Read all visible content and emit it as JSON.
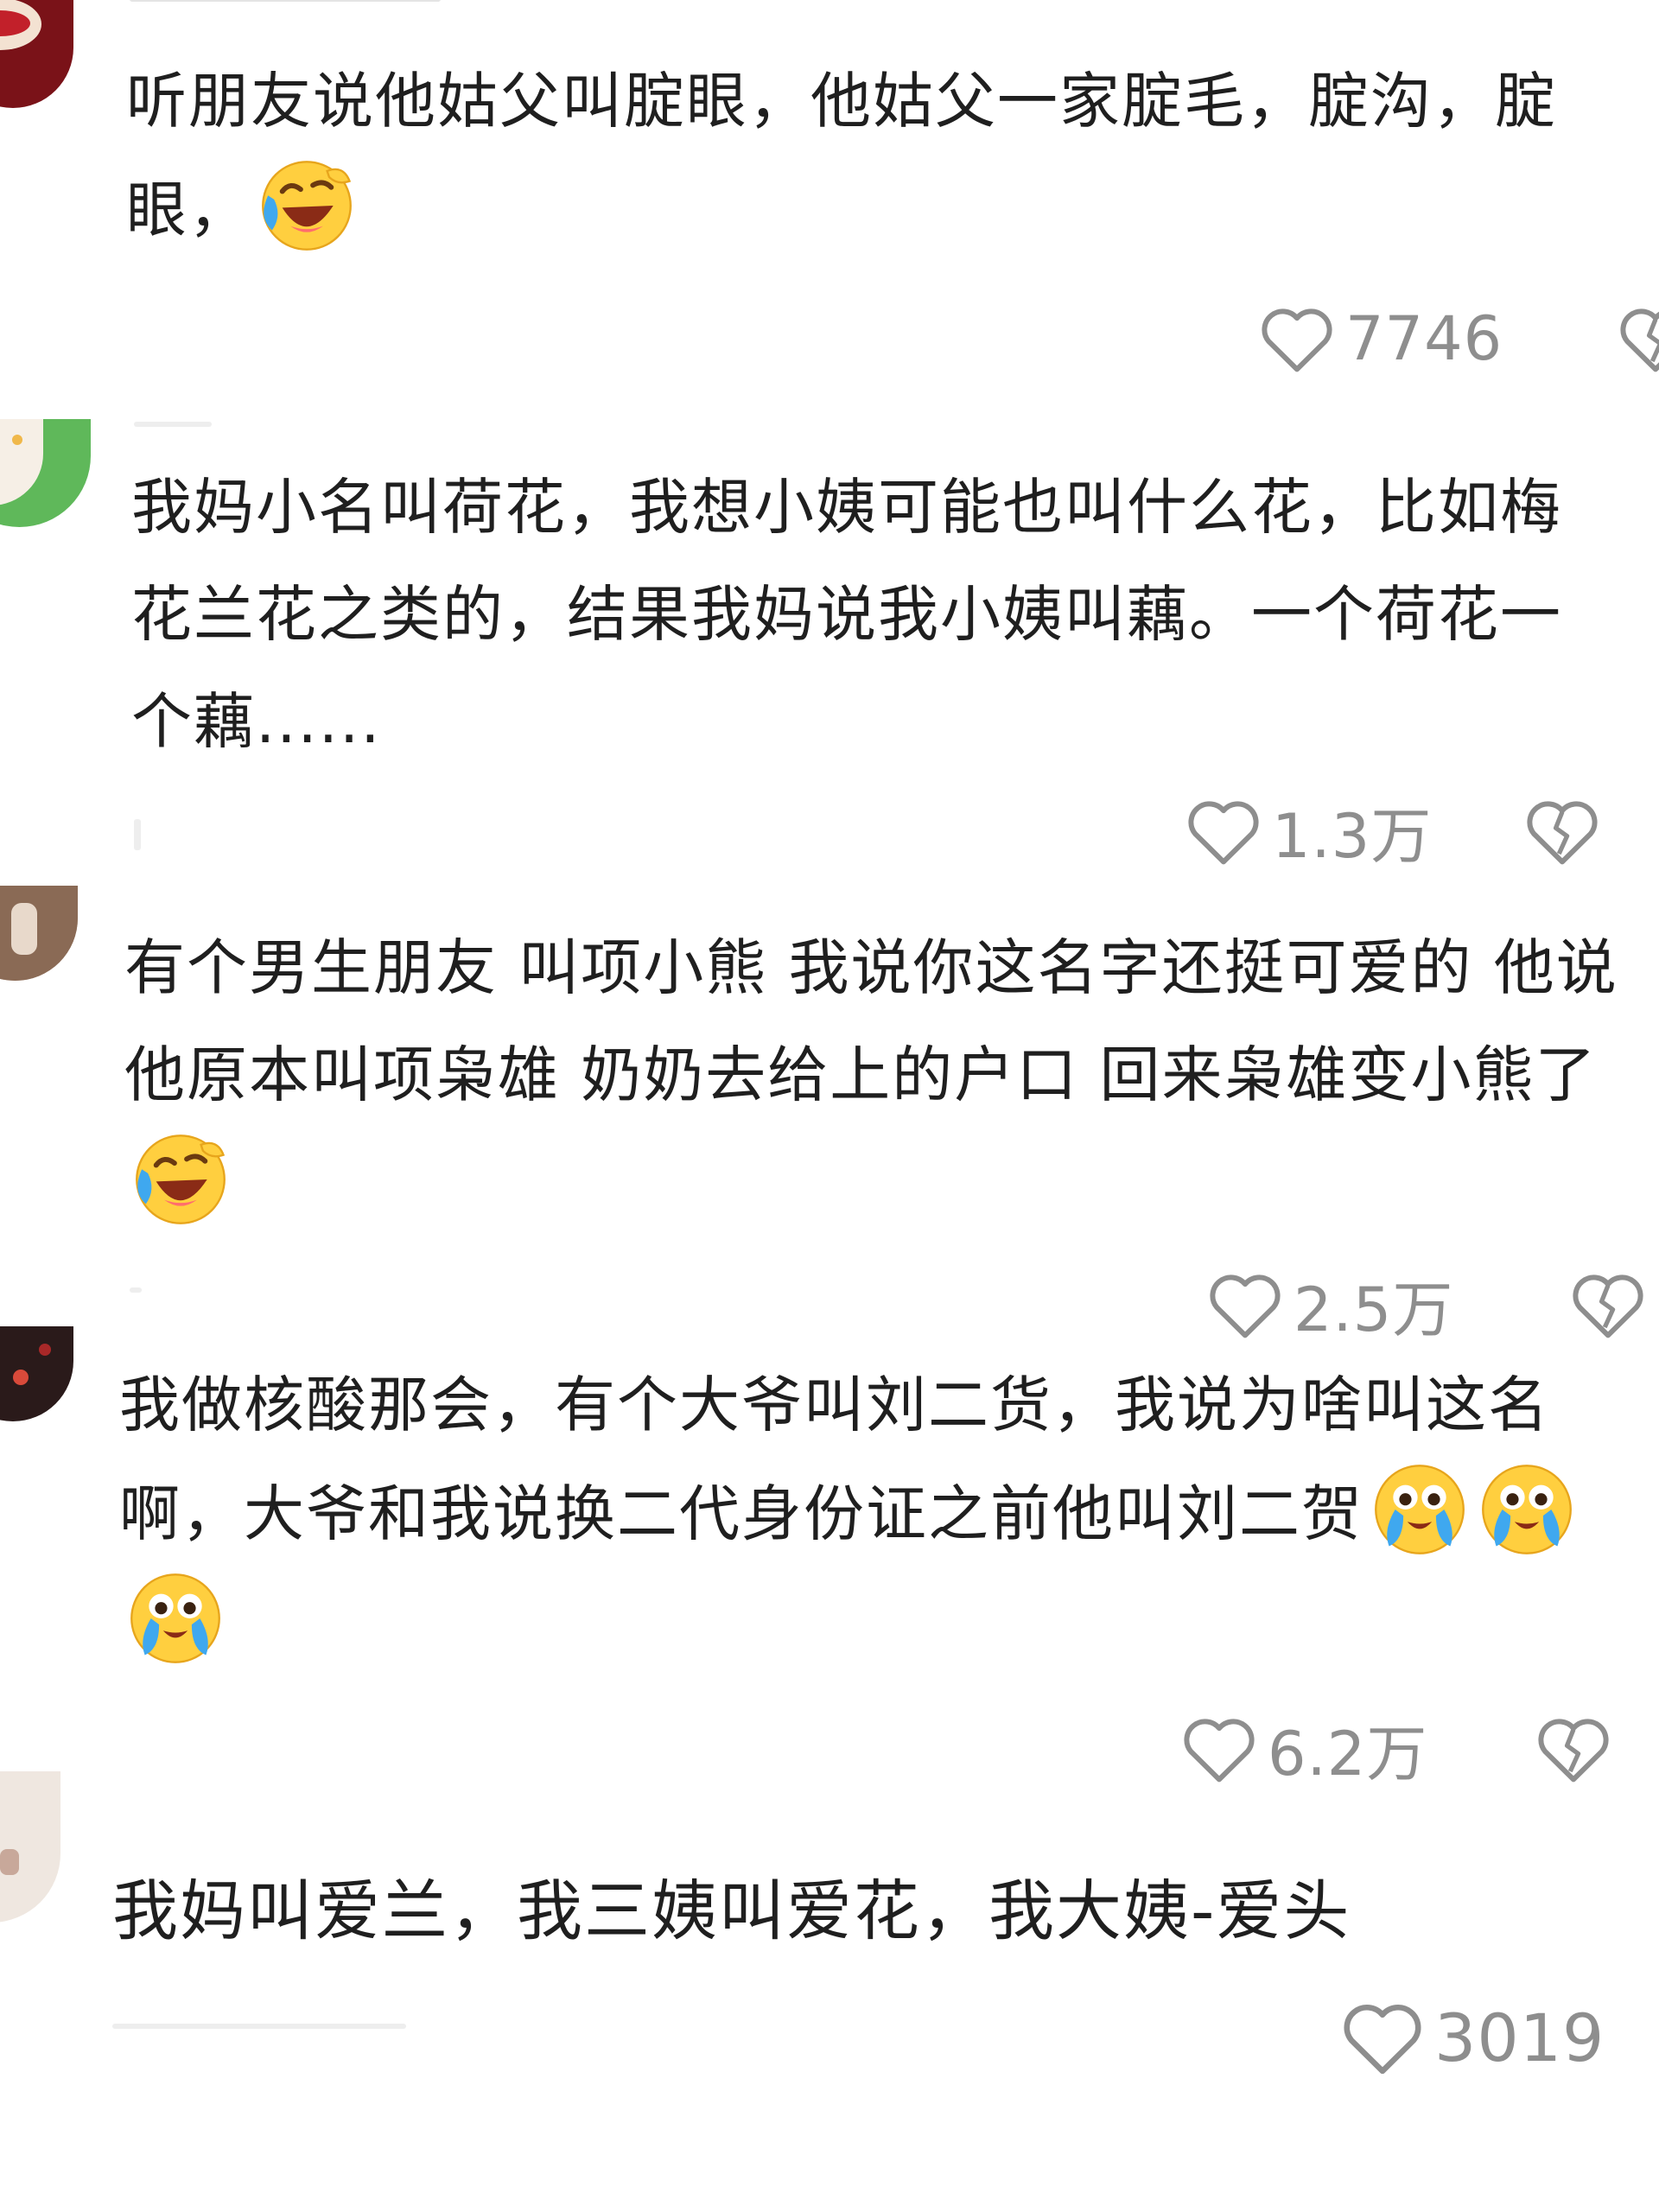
{
  "comments": [
    {
      "text": "听朋友说他姑父叫腚眼，他姑父一家腚毛，腚沟，腚眼，",
      "emoji": [
        "laugh-cry-emoji"
      ],
      "likes": "7746",
      "has_dislike": true
    },
    {
      "text": "我妈小名叫荷花，我想小姨可能也叫什么花，比如梅花兰花之类的，结果我妈说我小姨叫藕。一个荷花一个藕......",
      "emoji": [],
      "likes": "1.3万",
      "has_dislike": true
    },
    {
      "text": "有个男生朋友 叫项小熊 我说你这名字还挺可爱的 他说他原本叫项枭雄 奶奶去给上的户口 回来枭雄变小熊了",
      "emoji": [
        "laugh-cry-emoji"
      ],
      "likes": "2.5万",
      "has_dislike": true
    },
    {
      "text": "我做核酸那会，有个大爷叫刘二货，我说为啥叫这名啊，大爷和我说换二代身份证之前他叫刘二贺",
      "emoji": [
        "crying-emoji",
        "crying-emoji",
        "crying-emoji"
      ],
      "likes": "6.2万",
      "has_dislike": true
    },
    {
      "text": "我妈叫爱兰，我三姨叫爱花，我大姨-爱头",
      "emoji": [],
      "likes": "3019",
      "has_dislike": false
    }
  ],
  "colors": {
    "text": "#1f1f1f",
    "meta": "#8e8e8e",
    "emoji_yellow": "#ffcf3f",
    "tear_blue": "#3fa8ef"
  }
}
